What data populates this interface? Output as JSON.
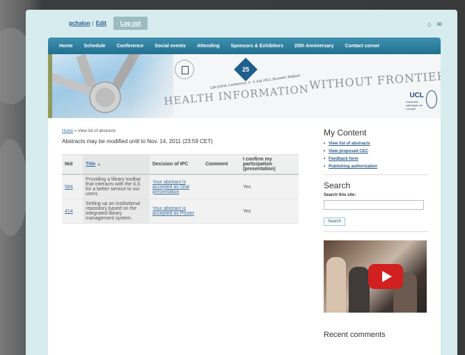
{
  "user": {
    "name": "pchalon",
    "separator": "|",
    "edit": "Edit",
    "logout": "Log out"
  },
  "top_icons": [
    "home-icon",
    "mail-icon"
  ],
  "nav": [
    "Home",
    "Schedule",
    "Conference",
    "Social events",
    "Attending",
    "Sponsors & Exhibitors",
    "25th Anniversary",
    "Contact corner"
  ],
  "banner": {
    "tagline": "13th EAHIL Conference, 4 - 6 July 2012, Brussels, Belgium",
    "title_left": "HEALTH INFORMATION",
    "title_right": "WITHOUT FRONTIERS",
    "badge": "25",
    "ucl": "UCL",
    "ucl_sub": "Université catholique de Louvain"
  },
  "breadcrumb": {
    "home": "Home",
    "separator": "»",
    "current": "View list of abstracts"
  },
  "notice": "Abstracts may be modified until to Nov. 14, 2011 (23:59 CET)",
  "table": {
    "headers": {
      "nid": "Nid",
      "title": "Title",
      "decision": "Decision of IPC",
      "comment": "Comment",
      "confirm": "I confirm my participation (presentation)"
    },
    "rows": [
      {
        "nid": "584",
        "title": "Providing a library toolbar that interacts with the ILS for a better service to our users",
        "decision": "Your abstract is accepted as Oral presentation",
        "comment": "",
        "confirm": "Yes"
      },
      {
        "nid": "414",
        "title": "Setting up an institutional repository based on the integrated library management system.",
        "decision": "Your abstract is accepted as Poster",
        "comment": "",
        "confirm": "Yes"
      }
    ]
  },
  "sidebar": {
    "my_content_title": "My Content",
    "my_content_items": [
      "View list of abstracts",
      "View proposed CEC",
      "Feedback form",
      "Publishing authorization"
    ],
    "search_title": "Search",
    "search_label": "Search this site:",
    "search_button": "Search",
    "recent_title": "Recent comments"
  }
}
